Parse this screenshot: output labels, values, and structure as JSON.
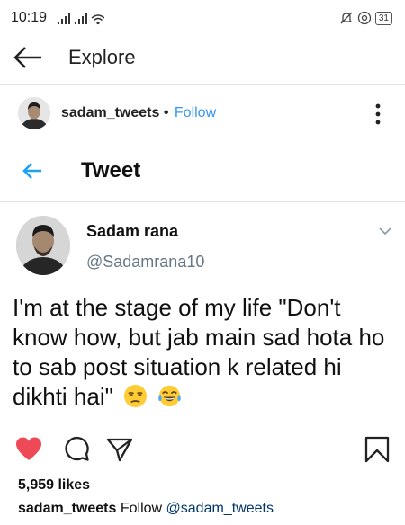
{
  "status_bar": {
    "time": "10:19",
    "battery": "31"
  },
  "header": {
    "title": "Explore"
  },
  "post": {
    "username": "sadam_tweets",
    "separator": " • ",
    "follow_label": "Follow",
    "tweet": {
      "heading": "Tweet",
      "display_name": "Sadam rana",
      "handle": "@Sadamrana10",
      "text": "I'm at the stage of my life \"Don't know how, but jab main sad hota ho  to sab post situation k related hi dikhti hai\"",
      "emojis": [
        "unamused-face",
        "tears-of-joy-face"
      ]
    },
    "likes": "5,959 likes",
    "caption": {
      "username": "sadam_tweets",
      "follow_label": "Follow",
      "mention": "@sadam_tweets"
    }
  },
  "colors": {
    "link_blue": "#3897f0",
    "like_red": "#ed4956",
    "twitter_blue": "#1da1f2",
    "handle_gray": "#657786"
  }
}
